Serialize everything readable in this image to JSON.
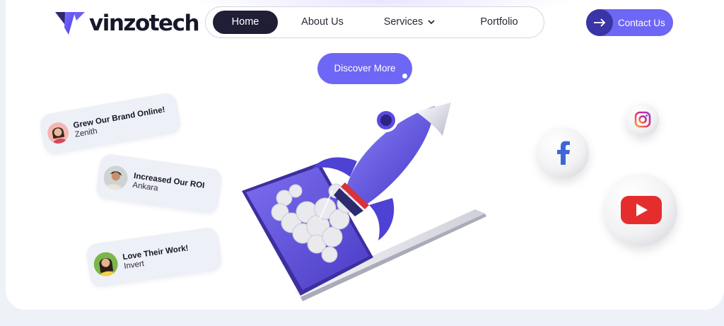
{
  "brand": {
    "name": "vinzotech",
    "accent": "#6e66f4",
    "dark": "#1f1e36"
  },
  "nav": {
    "items": [
      {
        "label": "Home",
        "active": true
      },
      {
        "label": "About Us"
      },
      {
        "label": "Services",
        "icon": "chevron-down-icon"
      },
      {
        "label": "Portfolio"
      }
    ]
  },
  "header": {
    "contact_label": "Contact Us",
    "contact_icon": "arrow-right-icon"
  },
  "hero": {
    "cta_label": "Discover More"
  },
  "testimonials": [
    {
      "title": "Grew Our Brand Online!",
      "company": "Zenith"
    },
    {
      "title": "Increased Our ROI",
      "company": "Ankara"
    },
    {
      "title": "Love Their Work!",
      "company": "Invert"
    }
  ],
  "social_icons": [
    "facebook-icon",
    "instagram-icon",
    "youtube-icon"
  ]
}
